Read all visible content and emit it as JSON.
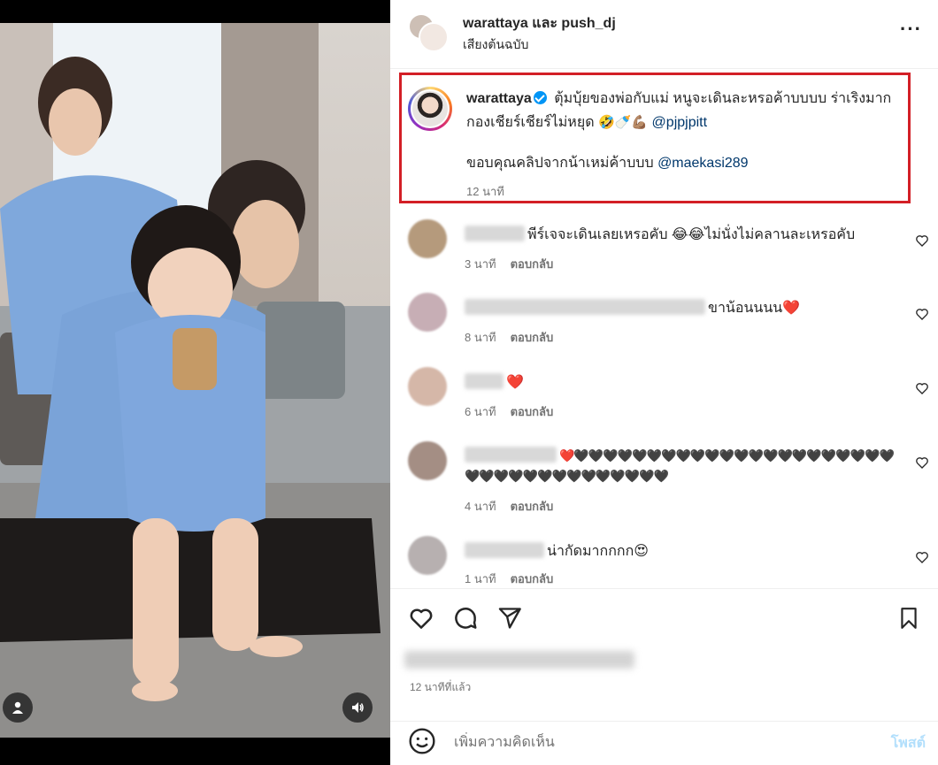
{
  "header": {
    "title": "warattaya และ push_dj",
    "subtitle": "เสียงต้นฉบับ",
    "more_icon": "more-horizontal-icon"
  },
  "caption": {
    "username": "warattaya",
    "line1": "ตุ้มบุ้ยของพ่อกับแม่ หนูจะเดินละหรอค้าบบบบ ร่าเริงมาก กองเชียร์เชียร์ไม่หยุด",
    "emojis": "🤣🍼💪🏽",
    "mention1": "@pjpjpitt",
    "line2": "ขอบคุณคลิปจากน้าเหม่ค้าบบบ",
    "mention2": "@maekasi289",
    "time": "12 นาที"
  },
  "comments": [
    {
      "text": "พีร์เจจะเดินเลยเหรอคับ 😂😂ไม่นั่งไม่คลานละเหรอคับ",
      "time": "3 นาที",
      "reply": "ตอบกลับ"
    },
    {
      "text": "ขาน้อนนนน❤️",
      "time": "8 นาที",
      "reply": "ตอบกลับ"
    },
    {
      "text": "❤️",
      "time": "6 นาที",
      "reply": "ตอบกลับ"
    },
    {
      "text": "❤️🖤🖤🖤🖤🖤🖤🖤🖤🖤🖤🖤🖤🖤🖤🖤🖤🖤🖤🖤🖤🖤🖤🖤🖤🖤🖤🖤🖤🖤🖤🖤🖤🖤🖤🖤🖤",
      "time": "4 นาที",
      "reply": "ตอบกลับ"
    },
    {
      "text": "น่ากัดมากกกก😍",
      "time": "1 นาที",
      "reply": "ตอบกลับ"
    }
  ],
  "actions": {
    "post_time": "12 นาทีที่แล้ว"
  },
  "comment_bar": {
    "placeholder": "เพิ่มความคิดเห็น",
    "post_label": "โพสต์"
  },
  "colors": {
    "highlight_border": "#d31f26",
    "verified": "#0095f6",
    "mention": "#00376b",
    "muted": "#737373"
  }
}
